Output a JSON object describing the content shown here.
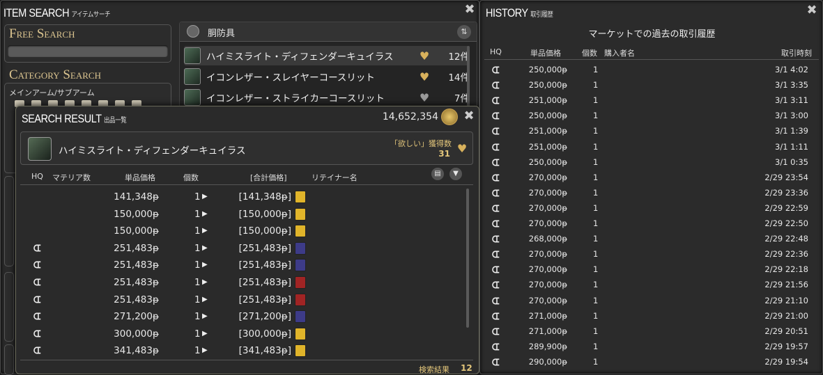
{
  "item_search": {
    "title": "ITEM SEARCH",
    "subtitle": "アイテムサーチ",
    "free_search": "Free Search",
    "category_search": "Category Search",
    "category_label": "メインアーム/サブアーム",
    "category_name": "胴防具",
    "items": [
      {
        "name": "ハイミスライト・ディフェンダーキュイラス",
        "count": "12件",
        "fav": true
      },
      {
        "name": "イコンレザー・スレイヤーコースリット",
        "count": "14件",
        "fav": true
      },
      {
        "name": "イコンレザー・ストライカーコースリット",
        "count": "7件",
        "fav": false
      }
    ]
  },
  "search_result": {
    "title": "SEARCH RESULT",
    "subtitle": "出品一覧",
    "gil": "14,652,354",
    "item_name": "ハイミスライト・ディフェンダーキュイラス",
    "wish_label": "「欲しい」獲得数",
    "wish_count": "31",
    "headers": {
      "hq": "HQ",
      "materia": "マテリア数",
      "unit": "単品価格",
      "qty": "個数",
      "total": "[合計価格]",
      "retainer": "リテイナー名"
    },
    "rows": [
      {
        "hq": false,
        "price": "141,348",
        "qty": "1",
        "total": "[141,348",
        "ret": "yel"
      },
      {
        "hq": false,
        "price": "150,000",
        "qty": "1",
        "total": "[150,000",
        "ret": "yel"
      },
      {
        "hq": false,
        "price": "150,000",
        "qty": "1",
        "total": "[150,000",
        "ret": "yel"
      },
      {
        "hq": true,
        "price": "251,483",
        "qty": "1",
        "total": "[251,483",
        "ret": "blu"
      },
      {
        "hq": true,
        "price": "251,483",
        "qty": "1",
        "total": "[251,483",
        "ret": "blu"
      },
      {
        "hq": true,
        "price": "251,483",
        "qty": "1",
        "total": "[251,483",
        "ret": "red"
      },
      {
        "hq": true,
        "price": "251,483",
        "qty": "1",
        "total": "[251,483",
        "ret": "red"
      },
      {
        "hq": true,
        "price": "271,200",
        "qty": "1",
        "total": "[271,200",
        "ret": "blu"
      },
      {
        "hq": true,
        "price": "300,000",
        "qty": "1",
        "total": "[300,000",
        "ret": "yel"
      },
      {
        "hq": true,
        "price": "341,483",
        "qty": "1",
        "total": "[341,483",
        "ret": "yel"
      }
    ],
    "footer_label": "検索結果",
    "footer_count": "12"
  },
  "history": {
    "title": "HISTORY",
    "subtitle": "取引履歴",
    "heading": "マーケットでの過去の取引履歴",
    "headers": {
      "hq": "HQ",
      "unit": "単品価格",
      "qty": "個数",
      "buyer": "購入者名",
      "time": "取引時刻"
    },
    "rows": [
      {
        "price": "250,000",
        "qty": "1",
        "time": "3/1 4:02"
      },
      {
        "price": "250,000",
        "qty": "1",
        "time": "3/1 3:35"
      },
      {
        "price": "251,000",
        "qty": "1",
        "time": "3/1 3:11"
      },
      {
        "price": "250,000",
        "qty": "1",
        "time": "3/1 3:00"
      },
      {
        "price": "251,000",
        "qty": "1",
        "time": "3/1 1:39"
      },
      {
        "price": "251,000",
        "qty": "1",
        "time": "3/1 1:11"
      },
      {
        "price": "250,000",
        "qty": "1",
        "time": "3/1 0:35"
      },
      {
        "price": "270,000",
        "qty": "1",
        "time": "2/29 23:54"
      },
      {
        "price": "270,000",
        "qty": "1",
        "time": "2/29 23:36"
      },
      {
        "price": "270,000",
        "qty": "1",
        "time": "2/29 22:59"
      },
      {
        "price": "270,000",
        "qty": "1",
        "time": "2/29 22:50"
      },
      {
        "price": "268,000",
        "qty": "1",
        "time": "2/29 22:48"
      },
      {
        "price": "270,000",
        "qty": "1",
        "time": "2/29 22:36"
      },
      {
        "price": "270,000",
        "qty": "1",
        "time": "2/29 22:18"
      },
      {
        "price": "270,000",
        "qty": "1",
        "time": "2/29 21:56"
      },
      {
        "price": "270,000",
        "qty": "1",
        "time": "2/29 21:10"
      },
      {
        "price": "271,000",
        "qty": "1",
        "time": "2/29 21:00"
      },
      {
        "price": "271,000",
        "qty": "1",
        "time": "2/29 20:51"
      },
      {
        "price": "289,900",
        "qty": "1",
        "time": "2/29 19:57"
      },
      {
        "price": "290,000",
        "qty": "1",
        "time": "2/29 19:54"
      }
    ]
  },
  "currency_symbol": "ᵽ",
  "hq_icon": "hq-icon",
  "colors": {
    "gold": "#e2c57a",
    "accent": "#d8b15c"
  }
}
